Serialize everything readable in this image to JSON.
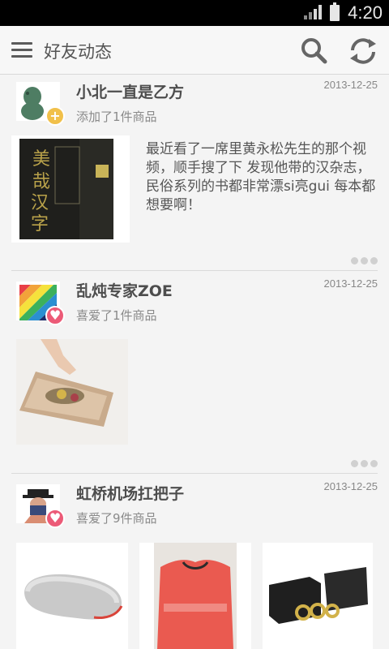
{
  "status_bar": {
    "time": "4:20"
  },
  "header": {
    "title": "好友动态"
  },
  "posts": [
    {
      "username": "小北一直是乙方",
      "date": "2013-12-25",
      "action": "添加了1件商品",
      "text": "最近看了一席里黄永松先生的那个视频，顺手搜了下 发现他带的汉杂志，民俗系列的书都非常漂si亮gui 每本都想要啊！",
      "badge": "+",
      "book_title": "美哉汉字"
    },
    {
      "username": "乱炖专家ZOE",
      "date": "2013-12-25",
      "action": "喜爱了1件商品",
      "badge": "♥"
    },
    {
      "username": "虹桥机场扛把子",
      "date": "2013-12-25",
      "action": "喜爱了9件商品",
      "badge": "♥"
    }
  ],
  "colors": {
    "plus_badge": "#f1c04a",
    "heart_badge": "#ec5a77",
    "title_text": "#555555"
  }
}
